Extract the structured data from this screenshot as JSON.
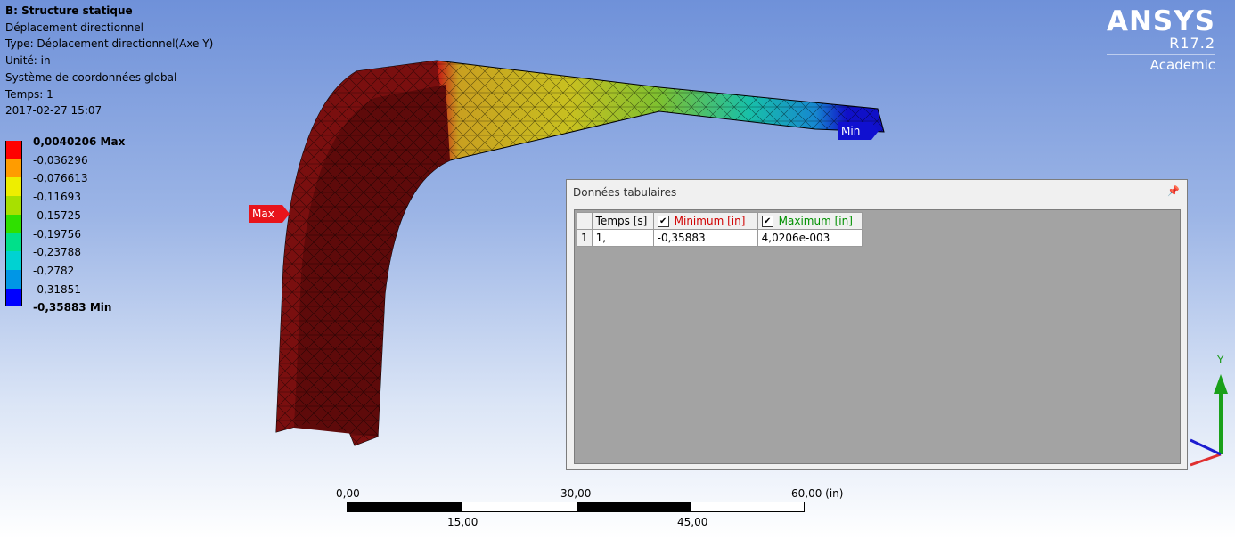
{
  "header": {
    "title": "B: Structure statique",
    "lines": [
      "Déplacement directionnel",
      "Type: Déplacement directionnel(Axe Y)",
      "Unité: in",
      "Système de coordonnées global",
      "Temps: 1",
      "2017-02-27 15:07"
    ]
  },
  "legend": {
    "labels": [
      "0,0040206 Max",
      "-0,036296",
      "-0,076613",
      "-0,11693",
      "-0,15725",
      "-0,19756",
      "-0,23788",
      "-0,2782",
      "-0,31851",
      "-0,35883 Min"
    ],
    "colors": [
      "#ff0000",
      "#ff9c00",
      "#eeee00",
      "#a8e000",
      "#2fe000",
      "#00e08a",
      "#00d2d2",
      "#0096e6",
      "#0000ff"
    ]
  },
  "logo": {
    "brand": "ANSYS",
    "version": "R17.2",
    "edition": "Academic"
  },
  "markers": {
    "max": "Max",
    "min": "Min"
  },
  "tabular": {
    "title": "Données tabulaires",
    "pin": "ᵖ",
    "headers": {
      "time": "Temps [s]",
      "min": "Minimum [in]",
      "max": "Maximum [in]"
    },
    "rows": [
      {
        "index": "1",
        "time": "1,",
        "min": "-0,35883",
        "max": "4,0206e-003"
      }
    ],
    "colors": {
      "min": "#d00000",
      "max": "#009000"
    }
  },
  "scale": {
    "t0": "0,00",
    "t30": "30,00",
    "t60": "60,00 (in)",
    "t15": "15,00",
    "t45": "45,00"
  },
  "triad": {
    "y": "Y"
  }
}
